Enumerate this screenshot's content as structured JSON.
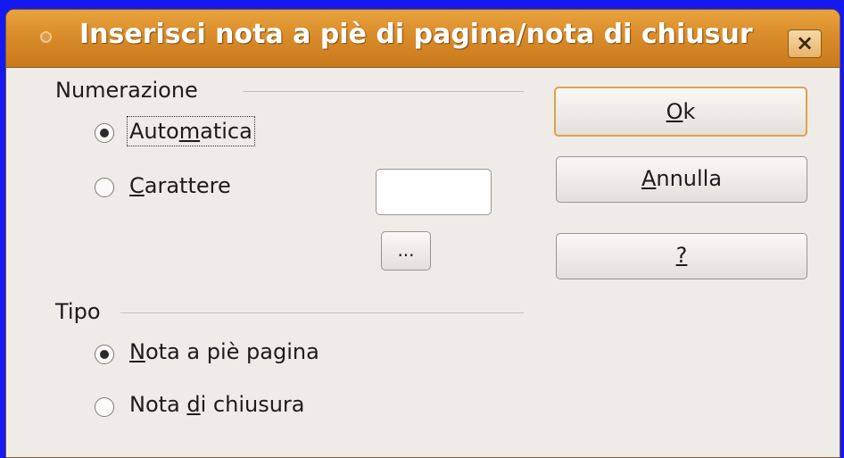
{
  "dialog": {
    "title": "Inserisci nota a piè di pagina/nota di chiusur",
    "close_label": "×"
  },
  "numbering": {
    "heading": "Numerazione",
    "auto": {
      "pre": "Auto",
      "mnemonic": "m",
      "post": "atica",
      "checked": true
    },
    "char": {
      "pre": "",
      "mnemonic": "C",
      "post": "arattere",
      "checked": false
    },
    "char_value": "",
    "char_browse_label": "..."
  },
  "type": {
    "heading": "Tipo",
    "footnote": {
      "pre": "",
      "mnemonic": "N",
      "post": "ota a piè pagina",
      "checked": true
    },
    "endnote": {
      "pre": "Nota ",
      "mnemonic": "d",
      "post": "i chiusura",
      "checked": false
    }
  },
  "buttons": {
    "ok": {
      "pre": "",
      "mnemonic": "O",
      "post": "k"
    },
    "cancel": {
      "pre": "",
      "mnemonic": "A",
      "post": "nnulla"
    },
    "help": {
      "pre": "",
      "mnemonic": "?",
      "post": ""
    }
  }
}
